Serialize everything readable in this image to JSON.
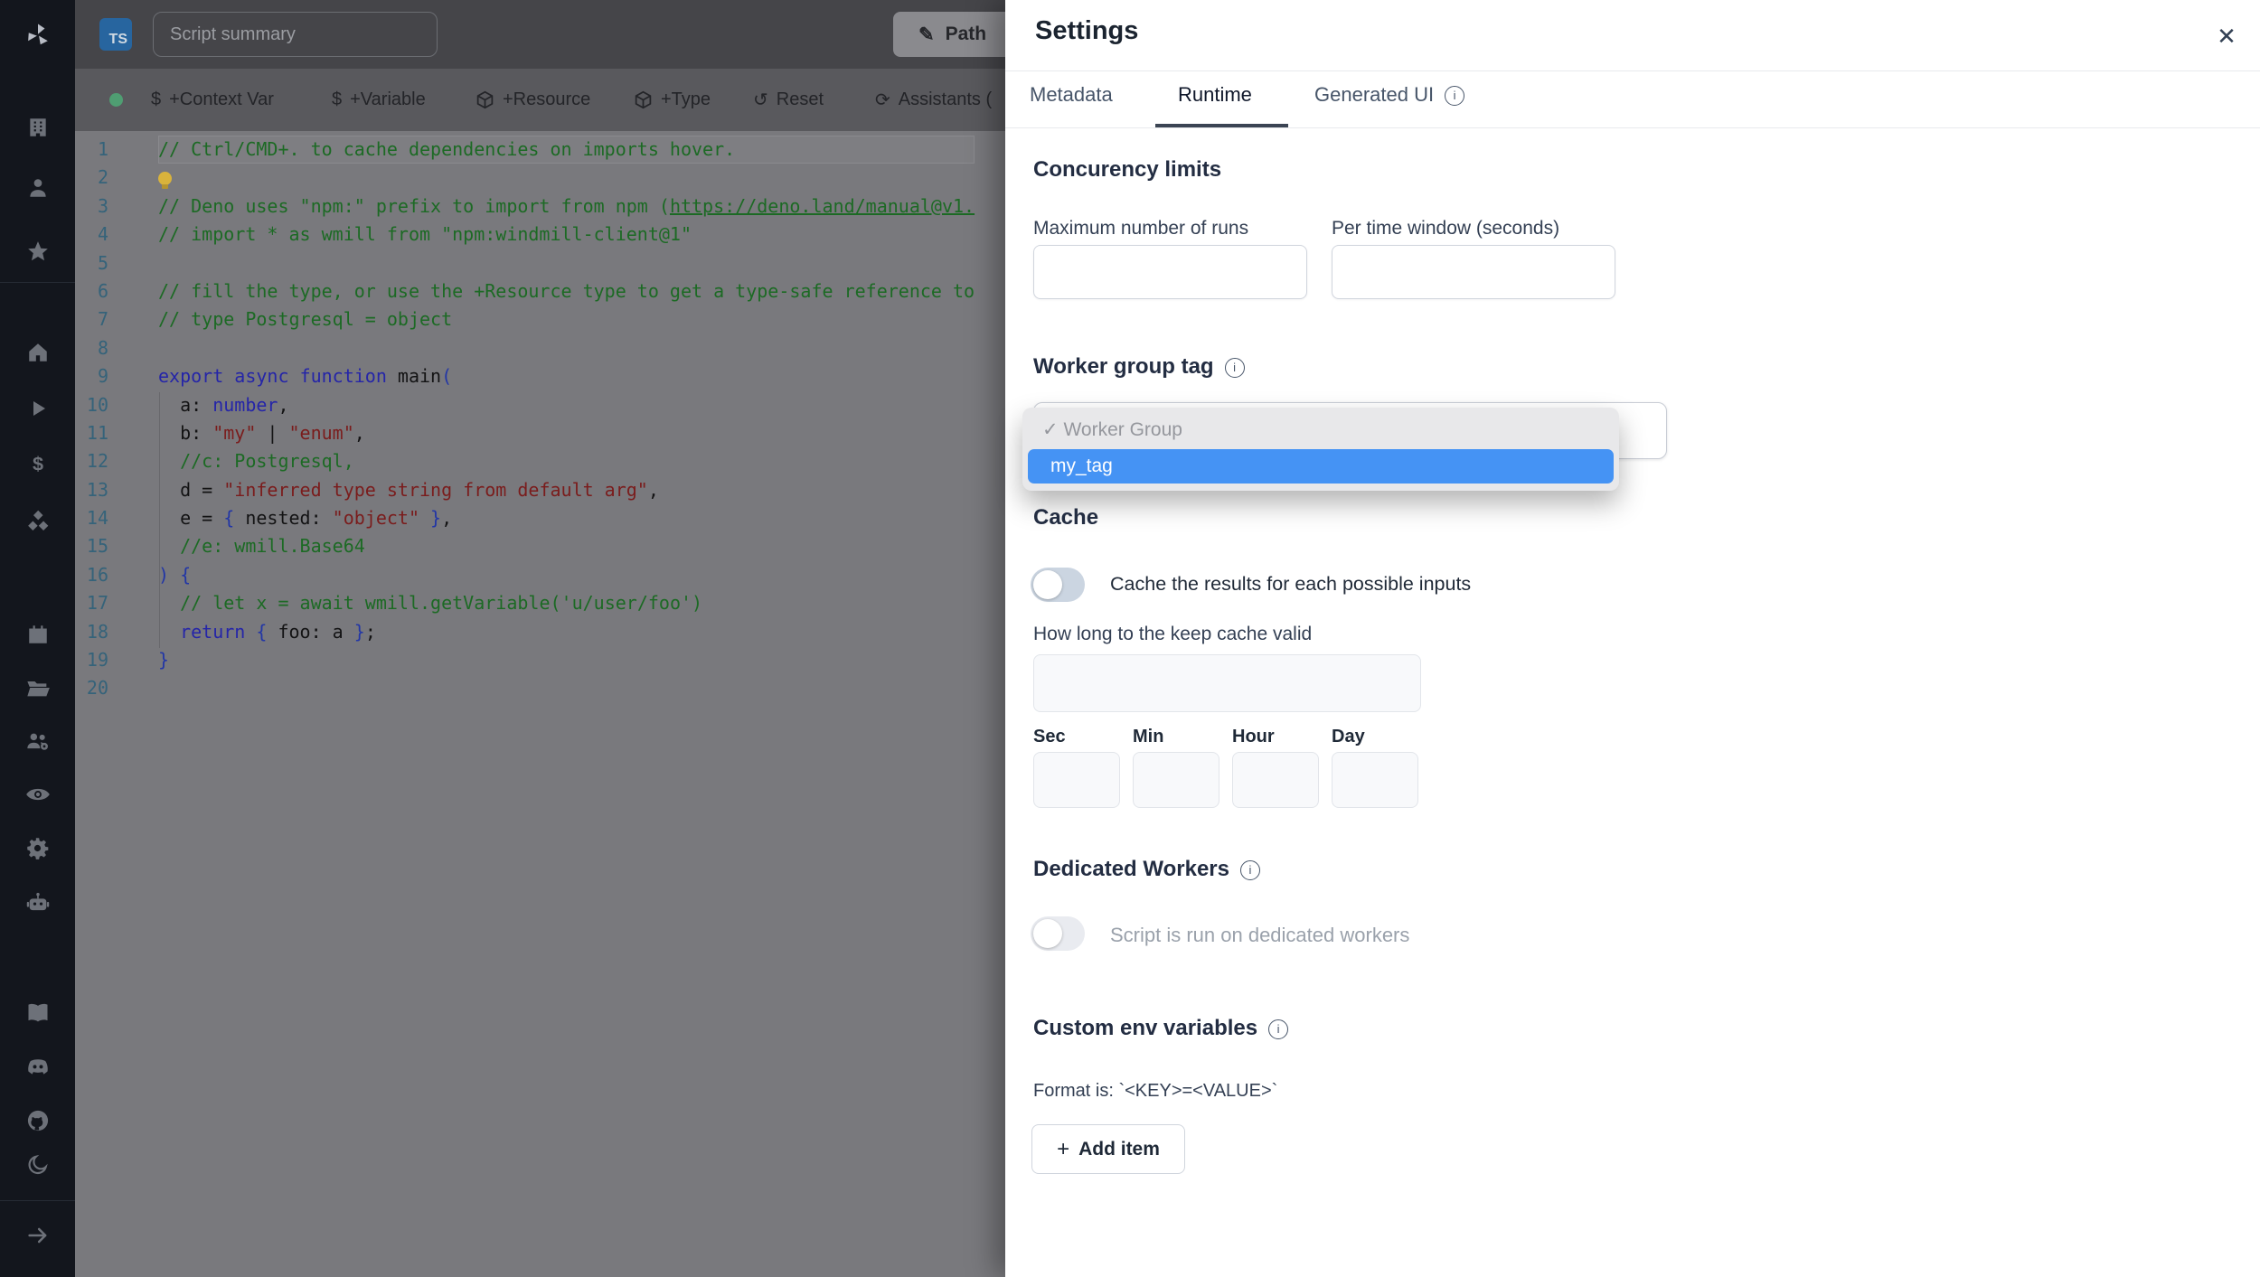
{
  "colors": {
    "accent_blue": "#4593f4",
    "ts_badge_blue": "#3178c6",
    "status_green": "#4f9e72",
    "toggle_off_track": "#cbd5e1",
    "drawer_bg": "#ffffff",
    "sidebar_bg": "#13161d"
  },
  "sidebar": {
    "icons": [
      "windmill-logo",
      "building",
      "person",
      "star",
      "home",
      "play",
      "dollar",
      "cubes",
      "calendar",
      "folder",
      "user-group-gear",
      "eye",
      "gear",
      "robot",
      "book",
      "discord",
      "github",
      "moon",
      "arrow-right"
    ]
  },
  "topbar": {
    "language_badge": "TS",
    "summary_value": "Script summary",
    "path_label": "Path",
    "path_icon_char": "✎"
  },
  "toolbar": {
    "items": [
      {
        "icon": "dollar-icon",
        "icon_char": "$",
        "label": "+Context Var"
      },
      {
        "icon": "dollar-icon",
        "icon_char": "$",
        "label": "+Variable"
      },
      {
        "icon": "cube-icon",
        "label": "+Resource"
      },
      {
        "icon": "cube-icon",
        "label": "+Type"
      },
      {
        "icon": "reset-icon",
        "icon_char": "↺",
        "label": "Reset"
      },
      {
        "icon": "assistants-icon",
        "icon_char": "⟳",
        "label": "Assistants ("
      }
    ]
  },
  "editor": {
    "lines": [
      {
        "current": true,
        "tokens": [
          [
            "c",
            "// Ctrl/CMD+. to cache dependencies on imports hover."
          ]
        ]
      },
      {
        "tokens": [
          [
            "bulb",
            ""
          ]
        ]
      },
      {
        "tokens": [
          [
            "c",
            "// Deno uses \"npm:\" prefix to import from npm ("
          ],
          [
            "u",
            "https://deno.land/manual@v1."
          ]
        ]
      },
      {
        "tokens": [
          [
            "c",
            "// import * as wmill from \"npm:windmill-client@1\""
          ]
        ]
      },
      {
        "tokens": []
      },
      {
        "tokens": [
          [
            "c",
            "// fill the type, or use the +Resource type to get a type-safe reference to"
          ]
        ]
      },
      {
        "tokens": [
          [
            "c",
            "// type Postgresql = object"
          ]
        ]
      },
      {
        "tokens": []
      },
      {
        "tokens": [
          [
            "k",
            "export"
          ],
          [
            "d",
            " "
          ],
          [
            "k",
            "async"
          ],
          [
            "d",
            " "
          ],
          [
            "k",
            "function"
          ],
          [
            "d",
            " main"
          ],
          [
            "b",
            "("
          ]
        ]
      },
      {
        "tokens": [
          [
            "d",
            "  a: "
          ],
          [
            "k",
            "number"
          ],
          [
            "d",
            ","
          ]
        ]
      },
      {
        "tokens": [
          [
            "d",
            "  b: "
          ],
          [
            "s",
            "\"my\""
          ],
          [
            "d",
            " | "
          ],
          [
            "s",
            "\"enum\""
          ],
          [
            "d",
            ","
          ]
        ]
      },
      {
        "tokens": [
          [
            "d",
            "  "
          ],
          [
            "c",
            "//c: Postgresql,"
          ]
        ]
      },
      {
        "tokens": [
          [
            "d",
            "  d = "
          ],
          [
            "s",
            "\"inferred type string from default arg\""
          ],
          [
            "d",
            ","
          ]
        ]
      },
      {
        "tokens": [
          [
            "d",
            "  e = "
          ],
          [
            "b",
            "{"
          ],
          [
            "d",
            " nested: "
          ],
          [
            "s",
            "\"object\""
          ],
          [
            "d",
            " "
          ],
          [
            "b",
            "}"
          ],
          [
            "d",
            ","
          ]
        ]
      },
      {
        "tokens": [
          [
            "d",
            "  "
          ],
          [
            "c",
            "//e: wmill.Base64"
          ]
        ]
      },
      {
        "tokens": [
          [
            "b",
            ") {"
          ]
        ]
      },
      {
        "tokens": [
          [
            "d",
            "  "
          ],
          [
            "c",
            "// let x = await wmill.getVariable('u/user/foo')"
          ]
        ]
      },
      {
        "tokens": [
          [
            "d",
            "  "
          ],
          [
            "k",
            "return"
          ],
          [
            "d",
            " "
          ],
          [
            "b",
            "{"
          ],
          [
            "d",
            " foo: a "
          ],
          [
            "b",
            "}"
          ],
          [
            "d",
            ";"
          ]
        ]
      },
      {
        "tokens": [
          [
            "b",
            "}"
          ]
        ]
      },
      {
        "tokens": []
      }
    ]
  },
  "settings": {
    "title": "Settings",
    "close_char": "✕",
    "tabs": [
      {
        "label": "Metadata",
        "active": false
      },
      {
        "label": "Runtime",
        "active": true
      },
      {
        "label": "Generated UI",
        "active": false,
        "info": true
      }
    ],
    "concurrency": {
      "heading": "Concurency limits",
      "max_runs_label": "Maximum number of runs",
      "window_label": "Per time window (seconds)",
      "max_runs_value": "",
      "window_value": ""
    },
    "worker_group": {
      "heading": "Worker group tag",
      "dropdown": {
        "check_char": "✓",
        "options": [
          {
            "label": "Worker Group",
            "checked": true,
            "highlighted": false
          },
          {
            "label": "my_tag",
            "checked": false,
            "highlighted": true
          }
        ]
      }
    },
    "cache": {
      "heading": "Cache",
      "toggle_label": "Cache the results for each possible inputs",
      "toggle_on": false,
      "duration_label": "How long to the keep cache valid",
      "duration_value": "",
      "units": [
        "Sec",
        "Min",
        "Hour",
        "Day"
      ],
      "unit_values": [
        "",
        "",
        "",
        ""
      ]
    },
    "dedicated": {
      "heading": "Dedicated Workers",
      "toggle_label": "Script is run on dedicated workers",
      "toggle_on": false
    },
    "env": {
      "heading": "Custom env variables",
      "format_hint": "Format is: `<KEY>=<VALUE>`",
      "add_label": "Add item",
      "add_icon_char": "+"
    }
  }
}
